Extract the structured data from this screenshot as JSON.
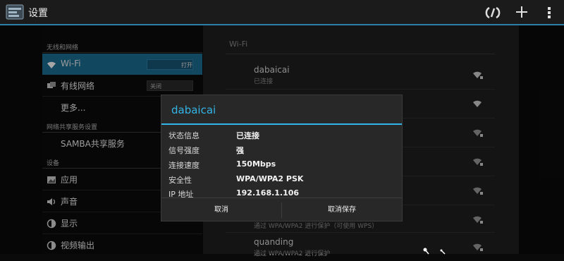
{
  "app": {
    "title": "设置"
  },
  "left": {
    "section_wireless": "无线和网络",
    "wifi": {
      "label": "Wi-Fi",
      "toggle": "打开"
    },
    "ethernet": {
      "label": "有线网络",
      "toggle": "关闭"
    },
    "more": "更多...",
    "section_sharing": "网络共享服务设置",
    "samba": "SAMBA共享服务",
    "section_device": "设备",
    "apps": "应用",
    "sound": "声音",
    "display": "显示",
    "video_out": "视频输出"
  },
  "right": {
    "header": "Wi-Fi",
    "networks": [
      {
        "name": "dabaicai",
        "status": "已连接"
      },
      {
        "name": "",
        "status": ""
      },
      {
        "name": "",
        "status": ""
      },
      {
        "name": "",
        "status": ""
      },
      {
        "name": "",
        "status": ""
      },
      {
        "name": "",
        "status": "通过 WPA/WPA2 进行保护（可使用 WPS）"
      },
      {
        "name": "quanding",
        "status": "通过 WPA/WPA2 进行保护"
      }
    ]
  },
  "dialog": {
    "title": "dabaicai",
    "rows": [
      {
        "key": "状态信息",
        "value": "已连接"
      },
      {
        "key": "信号强度",
        "value": "强"
      },
      {
        "key": "连接速度",
        "value": "150Mbps"
      },
      {
        "key": "安全性",
        "value": "WPA/WPA2 PSK"
      },
      {
        "key": "IP 地址",
        "value": "192.168.1.106"
      }
    ],
    "cancel": "取消",
    "save": "取消保存"
  },
  "colors": {
    "accent": "#33b5e5",
    "selected_row": "#1d6e94"
  }
}
